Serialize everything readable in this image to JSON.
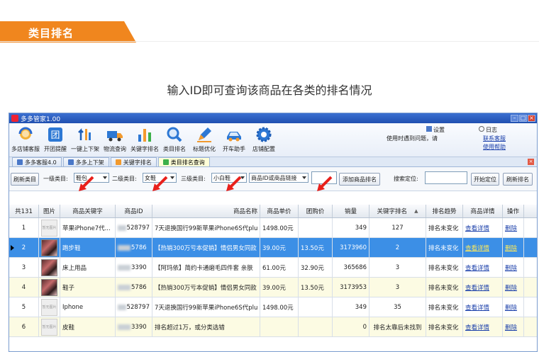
{
  "banner": {
    "title": "类目排名"
  },
  "subtitle": "输入ID即可查询该商品在各类的排名情况",
  "window": {
    "title": "多多管家1.00"
  },
  "toolbar": {
    "items": [
      {
        "label": "多店铺客服",
        "icon": "customer-service-icon"
      },
      {
        "label": "开团提醒",
        "icon": "group-icon"
      },
      {
        "label": "一键上下架",
        "icon": "updown-icon"
      },
      {
        "label": "物流查询",
        "icon": "truck-icon"
      },
      {
        "label": "关键字排名",
        "icon": "bar-chart-icon"
      },
      {
        "label": "类目排名",
        "icon": "search-icon"
      },
      {
        "label": "标题优化",
        "icon": "pencil-icon"
      },
      {
        "label": "开车助手",
        "icon": "car-icon"
      },
      {
        "label": "店铺配置",
        "icon": "gear-icon"
      }
    ],
    "settings": "设置",
    "log": "日志",
    "hint": "使用时遇到问题，请",
    "contact": "联系客服",
    "help": "使用帮助"
  },
  "tabs": [
    {
      "label": "多多客服4.0"
    },
    {
      "label": "多多上下架"
    },
    {
      "label": "关键字排名"
    },
    {
      "label": "类目排名查询",
      "active": true
    }
  ],
  "filters": {
    "refresh_category": "刷新类目",
    "level1_label": "一级类目:",
    "level1_value": "鞋包",
    "level2_label": "二级类目:",
    "level2_value": "女鞋",
    "level3_label": "三级类目:",
    "level3_value": "小白鞋",
    "id_type_value": "商品ID或商品链接",
    "add_button": "添加商品排名",
    "search_label": "搜索定位:",
    "locate_button": "开始定位",
    "refresh_ranking": "刷新排名"
  },
  "table": {
    "headers": {
      "count": "共131",
      "image": "图片",
      "keyword": "商品关键字",
      "id": "商品ID",
      "name": "商品名称",
      "price": "商品单价",
      "group_price": "团购价",
      "sales": "销量",
      "rank": "关键字排名",
      "trend": "排名趋势",
      "detail": "商品详情",
      "action": "操作"
    },
    "rows": [
      {
        "no": "1",
        "keyword": "苹果iPhone7代...",
        "id": "528797",
        "name": "7天退换国行99新苹果iPhone6S代plu",
        "price": "1498.00元",
        "group_price": "",
        "sales": "349",
        "rank": "127",
        "trend": "排名未变化",
        "detail": "查看详情",
        "action": "删除",
        "thumb": "placeholder"
      },
      {
        "no": "2",
        "keyword": "跑步鞋",
        "id": "5786",
        "name": "【热销300万亏本促销】情侣男女同款",
        "price": "39.00元",
        "group_price": "13.50元",
        "sales": "3173960",
        "rank": "2",
        "trend": "排名未变化",
        "detail": "查看详情",
        "action": "删除",
        "thumb": "photo",
        "selected": true
      },
      {
        "no": "3",
        "keyword": "床上用品",
        "id": "3390",
        "name": "【阿玛依】简约卡通磨毛四件套 亲肤",
        "price": "61.00元",
        "group_price": "32.90元",
        "sales": "365686",
        "rank": "3",
        "trend": "排名未变化",
        "detail": "查看详情",
        "action": "删除",
        "thumb": "photo"
      },
      {
        "no": "4",
        "keyword": "鞋子",
        "id": "5786",
        "name": "【热销300万亏本促销】情侣男女同款",
        "price": "39.00元",
        "group_price": "13.50元",
        "sales": "3173953",
        "rank": "3",
        "trend": "排名未变化",
        "detail": "查看详情",
        "action": "删除",
        "thumb": "photo",
        "alt": true
      },
      {
        "no": "5",
        "keyword": "Iphone",
        "id": "528797",
        "name": "7天退换国行99新苹果iPhone6S代plu",
        "price": "1498.00元",
        "group_price": "",
        "sales": "349",
        "rank": "35",
        "trend": "排名未变化",
        "detail": "查看详情",
        "action": "删除",
        "thumb": "placeholder"
      },
      {
        "no": "6",
        "keyword": "皮鞋",
        "id": "3390",
        "name": "排名超过1万，或分类选错",
        "price": "",
        "group_price": "",
        "sales": "0",
        "rank": "排名太靠后未找到",
        "trend": "排名未变化",
        "detail": "查看详情",
        "action": "删除",
        "thumb": "placeholder",
        "alt": true
      }
    ]
  },
  "placeholder_thumb_text": "暂无图片",
  "colors": {
    "banner": "#f0861e",
    "selected_row": "#3c8fe6",
    "alt_row": "#fcfbe3",
    "link": "#1a3faa"
  }
}
